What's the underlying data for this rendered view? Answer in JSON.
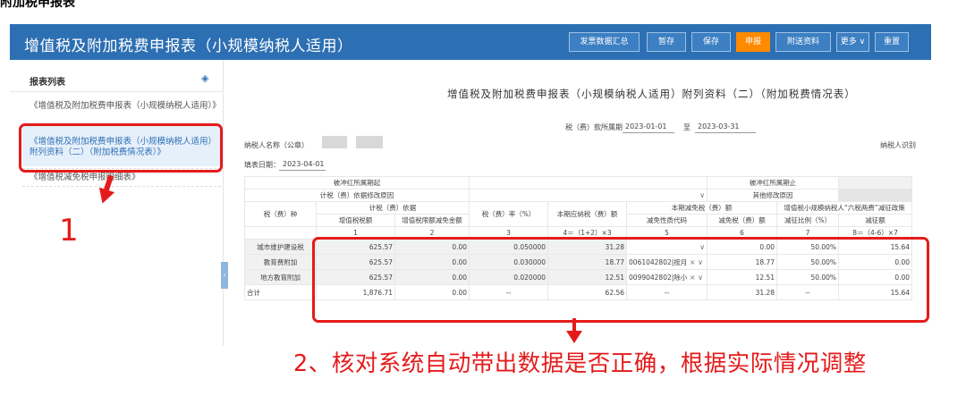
{
  "page_header_fragment": "附加税申报表",
  "window": {
    "title": "增值税及附加税费申报表（小规模纳税人适用）"
  },
  "toolbar": {
    "buttons": [
      "发票数据汇总",
      "暂存",
      "保存",
      "申报",
      "附送资料",
      "更多",
      "重置"
    ],
    "more_caret": "∨"
  },
  "sidebar": {
    "header": "报表列表",
    "items": [
      "《增值税及附加税费申报表（小规模纳税人适用）》",
      "《增值税及附加税费申报表（小规模纳税人适用）附列资料（二）（附加税费情况表）》",
      "《增值税减免税申报明细表》"
    ]
  },
  "form": {
    "title": "增值税及附加税费申报表（小规模纳税人适用）附列资料（二）（附加税费情况表）",
    "period_label": "税（费）款所属期",
    "period_start": "2023-01-01",
    "period_to": "至",
    "period_end": "2023-03-31",
    "taxpayer_name_label": "纳税人名称（公章）",
    "taxpayer_id_label": "纳税人识别",
    "fill_date_label": "填表日期：",
    "fill_date": "2023-04-01"
  },
  "table": {
    "row_offset_start": "被冲红所属期起",
    "row_offset_end": "被冲红所属期止",
    "row_basis_reason": "计税（费）依据修改原因",
    "row_other_reason": "其他修改原因",
    "header_tax_type": "税（费）种",
    "header_basis": "计税（费）依据",
    "header_vat": "增值税税额",
    "header_limit_reduction": "增值税限额减免金额",
    "header_rate": "税（费）率（%）",
    "header_current_payable": "本期应纳税（费）额",
    "header_reduction_group": "本期减免税（费）额",
    "header_reduction_code": "减免性质代码",
    "header_reduction_amount": "减免税（费）额",
    "header_six_taxes": "增值税小规模纳税人“六税两费”减征政策",
    "header_reduction_ratio": "减征比例（%）",
    "header_reduction_sum": "减征额",
    "col_numbers": [
      "1",
      "2",
      "3",
      "4＝（1+2）×3",
      "5",
      "6",
      "7",
      "8＝（4-6）×7"
    ],
    "rows": [
      {
        "name": "城市维护建设税",
        "vat": "625.57",
        "limit": "0.00",
        "rate": "0.050000",
        "payable": "31.28",
        "code": "",
        "reduction": "0.00",
        "ratio": "50.00%",
        "reduction_sum": "15.64"
      },
      {
        "name": "教育费附加",
        "vat": "625.57",
        "limit": "0.00",
        "rate": "0.030000",
        "payable": "18.77",
        "code": "0061042802|按月",
        "reduction": "18.77",
        "ratio": "50.00%",
        "reduction_sum": "0.00"
      },
      {
        "name": "地方教育附加",
        "vat": "625.57",
        "limit": "0.00",
        "rate": "0.020000",
        "payable": "12.51",
        "code": "0099042802|除小",
        "reduction": "12.51",
        "ratio": "50.00%",
        "reduction_sum": "0.00"
      }
    ],
    "total": {
      "name": "合计",
      "vat": "1,876.71",
      "limit": "0.00",
      "rate": "--",
      "payable": "62.56",
      "code": "--",
      "reduction": "31.28",
      "ratio": "--",
      "reduction_sum": "15.64"
    }
  },
  "annotations": {
    "label_1": "1",
    "label_2": "2、核对系统自动带出数据是否正确，根据实际情况调整",
    "color": "#e51b1b"
  },
  "colors": {
    "header_bar": "#2d6fb3",
    "primary_button": "#ff8a00",
    "selected_item": "#2d6fb3"
  },
  "icons": [
    "layers-icon",
    "chevron-down-icon",
    "clear-icon",
    "collapse-arrow-icon"
  ]
}
